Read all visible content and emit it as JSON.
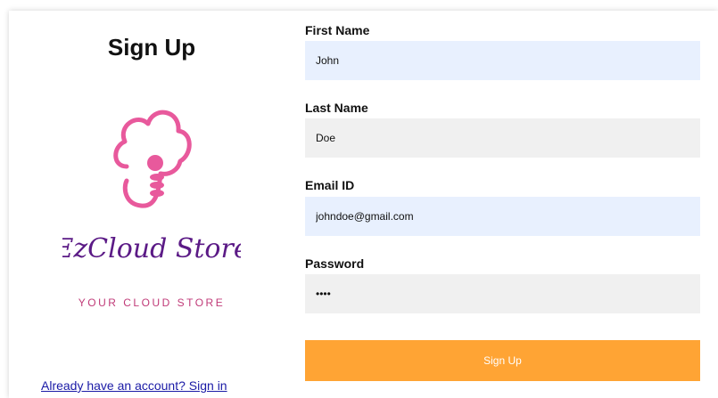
{
  "page": {
    "title": "Sign Up",
    "signin_link": "Already have an account? Sign in"
  },
  "logo": {
    "brand": "EzCloud Store",
    "tagline": "YOUR CLOUD STORE",
    "icon": "cloud-database-icon"
  },
  "form": {
    "first_name": {
      "label": "First Name",
      "value": "John"
    },
    "last_name": {
      "label": "Last Name",
      "value": "Doe"
    },
    "email": {
      "label": "Email ID",
      "value": "johndoe@gmail.com"
    },
    "password": {
      "label": "Password",
      "value": "••••"
    },
    "submit_label": "Sign Up"
  },
  "colors": {
    "autofill_bg": "#e8f0fe",
    "input_bg": "#f0f0f0",
    "button_bg": "#ffa434",
    "logo_pink": "#e8599c",
    "logo_purple": "#5b1a86",
    "tagline": "#c03a78"
  }
}
